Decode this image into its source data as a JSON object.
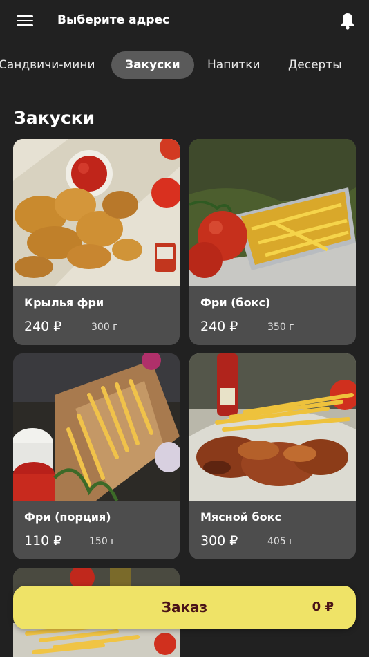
{
  "header": {
    "address": "Выберите адрес"
  },
  "tabs": [
    {
      "label": "Сандвичи-мини"
    },
    {
      "label": "Закуски"
    },
    {
      "label": "Напитки"
    },
    {
      "label": "Десерты"
    }
  ],
  "section": {
    "title": "Закуски"
  },
  "products": [
    {
      "name": "Крылья  фри",
      "price": "240 ₽",
      "weight": "300 г"
    },
    {
      "name": "Фри (бокс)",
      "price": "240 ₽",
      "weight": "350 г"
    },
    {
      "name": "Фри (порция)",
      "price": "110 ₽",
      "weight": "150 г"
    },
    {
      "name": "Мясной бокс",
      "price": "300 ₽",
      "weight": "405 г"
    }
  ],
  "order": {
    "label": "Заказ",
    "total": "0 ₽"
  },
  "colors": {
    "background": "#212121",
    "active_tab": "#5a5a5a",
    "card": "#4d4d4d",
    "order_bar": "#efe367",
    "order_text": "#4a1418"
  },
  "icons": [
    "menu-icon",
    "bell-icon"
  ]
}
